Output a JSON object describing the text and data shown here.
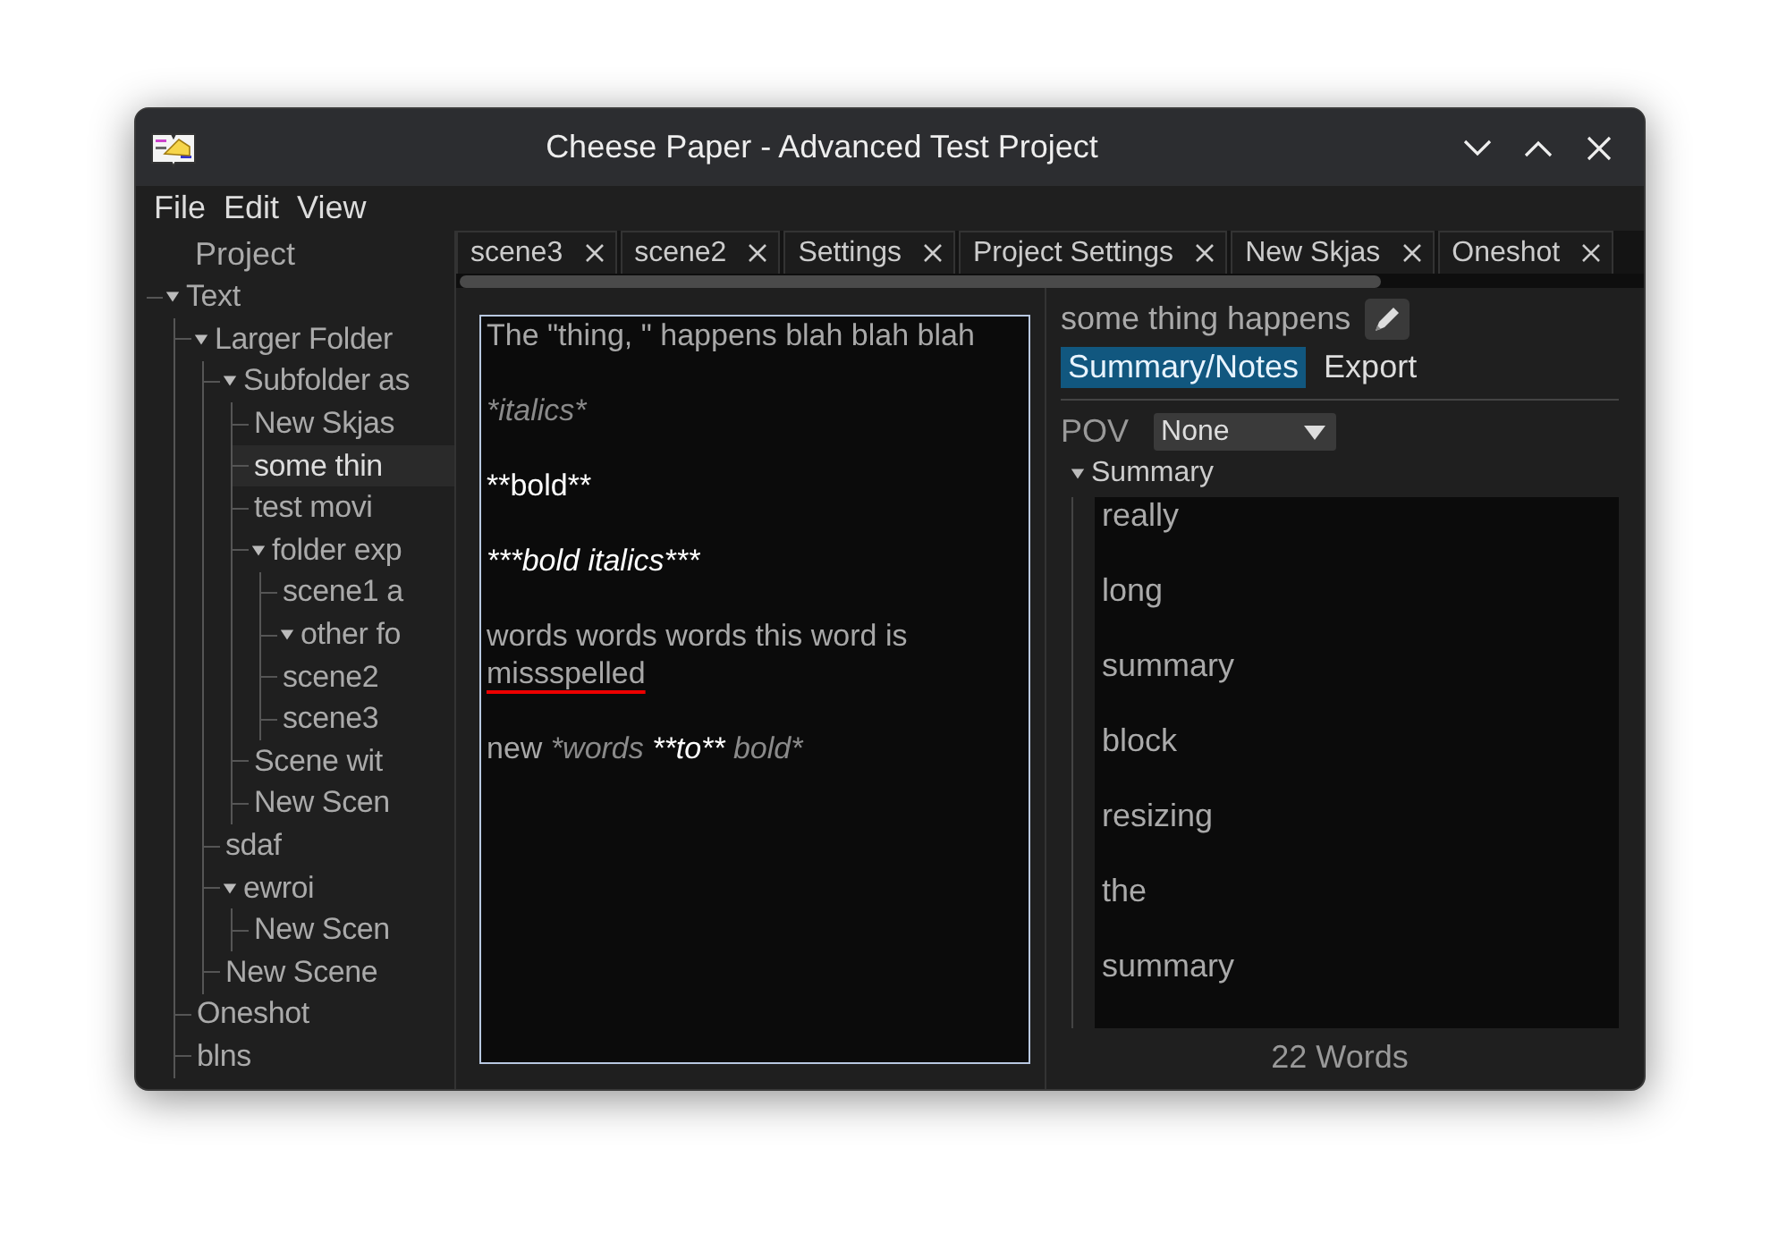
{
  "window": {
    "title": "Cheese Paper - Advanced Test Project"
  },
  "menu": [
    "File",
    "Edit",
    "View"
  ],
  "sidebar": {
    "heading": "Project",
    "items": [
      {
        "label": "Text",
        "expanded": true,
        "selected": false,
        "children": [
          {
            "label": "Larger Folder",
            "expanded": true,
            "selected": false,
            "children": [
              {
                "label": "Subfolder as",
                "expanded": true,
                "selected": false,
                "children": [
                  {
                    "label": "New Skjas",
                    "selected": false
                  },
                  {
                    "label": "some thin",
                    "selected": true
                  },
                  {
                    "label": "test movi",
                    "selected": false
                  },
                  {
                    "label": "folder exp",
                    "expanded": true,
                    "selected": false,
                    "children": [
                      {
                        "label": "scene1 a",
                        "selected": false
                      },
                      {
                        "label": "other fo",
                        "expanded": true,
                        "selected": false
                      },
                      {
                        "label": "scene2",
                        "selected": false
                      },
                      {
                        "label": "scene3",
                        "selected": false
                      }
                    ]
                  },
                  {
                    "label": "Scene wit",
                    "selected": false
                  },
                  {
                    "label": "New Scen",
                    "selected": false
                  }
                ]
              },
              {
                "label": "sdaf",
                "selected": false
              },
              {
                "label": "ewroi",
                "expanded": true,
                "selected": false,
                "children": [
                  {
                    "label": "New Scen",
                    "selected": false
                  }
                ]
              },
              {
                "label": "New Scene",
                "selected": false
              }
            ]
          },
          {
            "label": "Oneshot",
            "selected": false
          },
          {
            "label": "blns",
            "selected": false
          }
        ]
      }
    ]
  },
  "tabs": [
    "scene3",
    "scene2",
    "Settings",
    "Project Settings",
    "New Skjas",
    "Oneshot"
  ],
  "editor": {
    "paragraphs": [
      [
        {
          "text": "The \"thing, \" happens blah blah blah",
          "kind": "plain"
        }
      ],
      [
        {
          "text": "*italics*",
          "kind": "italic"
        }
      ],
      [
        {
          "text": "**bold**",
          "kind": "strong"
        }
      ],
      [
        {
          "text": "***bold italics***",
          "kind": "strongitalic"
        }
      ],
      [
        {
          "text": "words words words this word is ",
          "kind": "plain"
        },
        {
          "text": "missspelled",
          "kind": "misspelled"
        }
      ],
      [
        {
          "text": "new ",
          "kind": "plain"
        },
        {
          "text": "*words ",
          "kind": "italic"
        },
        {
          "text": "**to**",
          "kind": "strongitalic"
        },
        {
          "text": " bold*",
          "kind": "italic"
        }
      ]
    ]
  },
  "details": {
    "title": "some thing happens",
    "tabs": [
      {
        "label": "Summary/Notes",
        "selected": true
      },
      {
        "label": "Export",
        "selected": false
      }
    ],
    "pov_label": "POV",
    "pov_value": "None",
    "section": {
      "label": "Summary",
      "expanded": true
    },
    "summary_lines": [
      "really",
      "long",
      "summary",
      "block",
      "resizing",
      "the",
      "summary"
    ],
    "word_count": "22 Words"
  }
}
